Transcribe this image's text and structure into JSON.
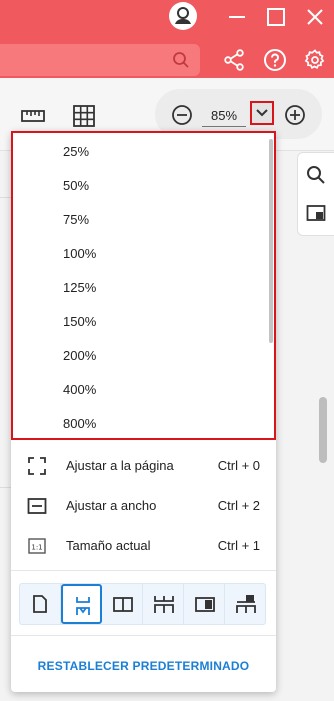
{
  "zoom": {
    "current": "85%",
    "options": [
      "25%",
      "50%",
      "75%",
      "100%",
      "125%",
      "150%",
      "200%",
      "400%",
      "800%"
    ]
  },
  "fit_options": [
    {
      "label": "Ajustar a la página",
      "shortcut": "Ctrl + 0"
    },
    {
      "label": "Ajustar a ancho",
      "shortcut": "Ctrl + 2"
    },
    {
      "label": "Tamaño actual",
      "shortcut": "Ctrl + 1"
    }
  ],
  "reset_label": "RESTABLECER PREDETERMINADO",
  "colors": {
    "titlebar": "#f05a5e",
    "highlight_border": "#d9141a",
    "accent": "#1b7fd6"
  },
  "icons": {
    "titlebar": [
      "user-avatar-icon",
      "minimize-icon",
      "maximize-icon",
      "close-icon",
      "search-icon",
      "share-icon",
      "help-icon",
      "settings-icon"
    ],
    "toolbar": [
      "ruler-icon",
      "grid-icon",
      "zoom-out-icon",
      "chevron-down-icon",
      "zoom-in-icon"
    ],
    "side": [
      "search-icon",
      "panel-icon"
    ],
    "layouts": [
      "single-page-icon",
      "continuous-page-icon",
      "two-page-icon",
      "two-page-continuous-icon",
      "cover-page-icon",
      "cover-continuous-icon"
    ]
  }
}
